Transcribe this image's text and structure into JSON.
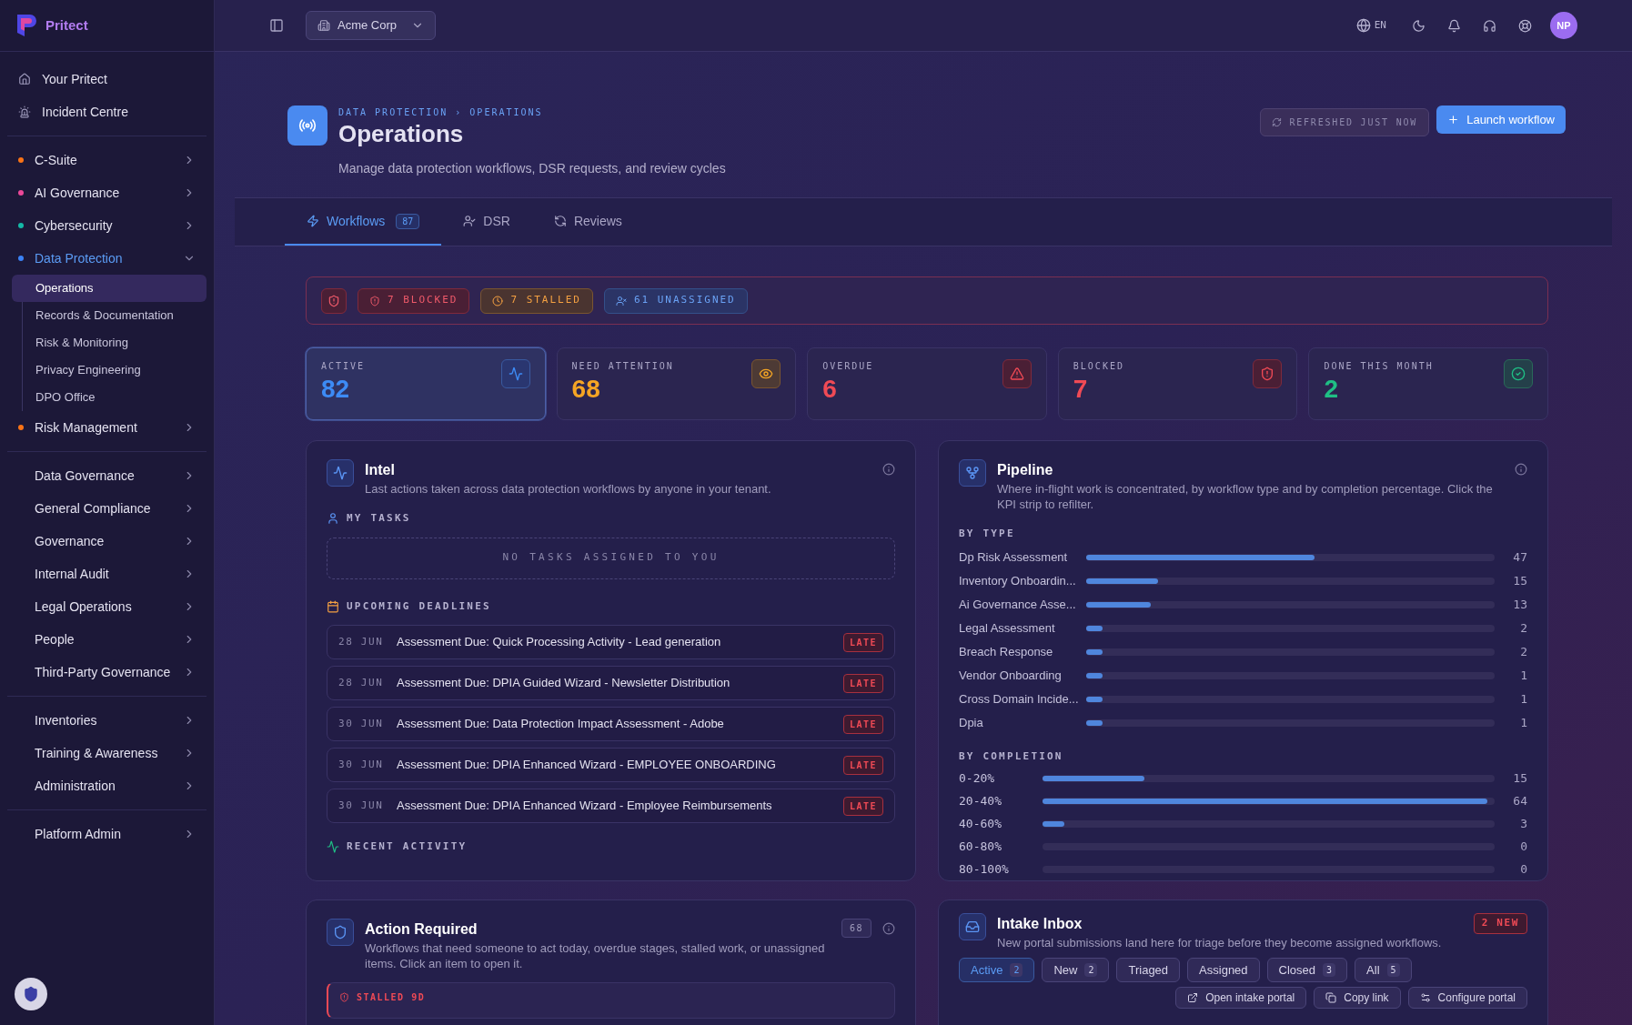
{
  "brand": {
    "name": "Pritect"
  },
  "sidebar": {
    "links": [
      {
        "label": "Your Pritect"
      },
      {
        "label": "Incident Centre"
      }
    ],
    "sections": [
      [
        {
          "label": "C-Suite",
          "color": "#f97316",
          "expanded": false
        },
        {
          "label": "AI Governance",
          "color": "#ec4899",
          "expanded": false
        },
        {
          "label": "Cybersecurity",
          "color": "#14b8a6",
          "expanded": false
        },
        {
          "label": "Data Protection",
          "color": "#3b82f6",
          "expanded": true,
          "children": [
            {
              "label": "Operations",
              "selected": true
            },
            {
              "label": "Records & Documentation",
              "selected": false
            },
            {
              "label": "Risk & Monitoring",
              "selected": false
            },
            {
              "label": "Privacy Engineering",
              "selected": false
            },
            {
              "label": "DPO Office",
              "selected": false
            }
          ]
        },
        {
          "label": "Risk Management",
          "color": "#f97316",
          "expanded": false
        }
      ],
      [
        {
          "label": "Data Governance",
          "expanded": false
        },
        {
          "label": "General Compliance",
          "expanded": false
        },
        {
          "label": "Governance",
          "expanded": false
        },
        {
          "label": "Internal Audit",
          "expanded": false
        },
        {
          "label": "Legal Operations",
          "expanded": false
        },
        {
          "label": "People",
          "expanded": false
        },
        {
          "label": "Third-Party Governance",
          "expanded": false
        }
      ],
      [
        {
          "label": "Inventories",
          "expanded": false
        },
        {
          "label": "Training & Awareness",
          "expanded": false
        },
        {
          "label": "Administration",
          "expanded": false
        }
      ],
      [
        {
          "label": "Platform Admin",
          "expanded": false
        }
      ]
    ]
  },
  "topbar": {
    "organization": "Acme Corp",
    "language": "EN",
    "avatar": "NP"
  },
  "page": {
    "breadcrumb": [
      "DATA PROTECTION",
      "OPERATIONS"
    ],
    "separator": "›",
    "title": "Operations",
    "subtitle": "Manage data protection workflows, DSR requests, and review cycles",
    "refresh": "REFRESHED JUST NOW",
    "launch": "Launch workflow"
  },
  "tabs": [
    {
      "label": "Workflows",
      "count": "87",
      "selected": true
    },
    {
      "label": "DSR",
      "selected": false
    },
    {
      "label": "Reviews",
      "selected": false
    }
  ],
  "alerts": [
    {
      "kind": "blocked",
      "label": "7 BLOCKED"
    },
    {
      "kind": "stalled",
      "label": "7 STALLED"
    },
    {
      "kind": "unassigned",
      "label": "61 UNASSIGNED"
    }
  ],
  "kpis": [
    {
      "kind": "active",
      "label": "ACTIVE",
      "value": "82",
      "selected": true
    },
    {
      "kind": "attention",
      "label": "NEED ATTENTION",
      "value": "68",
      "selected": false
    },
    {
      "kind": "overdue",
      "label": "OVERDUE",
      "value": "6",
      "selected": false
    },
    {
      "kind": "blocked",
      "label": "BLOCKED",
      "value": "7",
      "selected": false
    },
    {
      "kind": "done",
      "label": "DONE THIS MONTH",
      "value": "2",
      "selected": false
    }
  ],
  "intel": {
    "title": "Intel",
    "description": "Last actions taken across data protection workflows by anyone in your tenant.",
    "my_tasks": "MY TASKS",
    "empty": "NO TASKS ASSIGNED TO YOU",
    "deadlines_heading": "UPCOMING DEADLINES",
    "deadlines": [
      {
        "date": "28 JUN",
        "title": "Assessment Due: Quick Processing Activity - Lead generation",
        "status": "LATE"
      },
      {
        "date": "28 JUN",
        "title": "Assessment Due: DPIA Guided Wizard - Newsletter Distribution",
        "status": "LATE"
      },
      {
        "date": "30 JUN",
        "title": "Assessment Due: Data Protection Impact Assessment - Adobe",
        "status": "LATE"
      },
      {
        "date": "30 JUN",
        "title": "Assessment Due: DPIA Enhanced Wizard - EMPLOYEE ONBOARDING",
        "status": "LATE"
      },
      {
        "date": "30 JUN",
        "title": "Assessment Due: DPIA Enhanced Wizard - Employee Reimbursements",
        "status": "LATE"
      }
    ],
    "recent_heading": "RECENT ACTIVITY"
  },
  "pipeline": {
    "title": "Pipeline",
    "description": "Where in-flight work is concentrated, by workflow type and by completion percentage. Click the KPI strip to refilter.",
    "by_type_heading": "BY TYPE",
    "by_type": [
      {
        "label": "Dp Risk Assessment",
        "level": 0.57,
        "count": "47"
      },
      {
        "label": "Inventory Onboardin...",
        "level": 0.18,
        "count": "15"
      },
      {
        "label": "Ai Governance Asse...",
        "level": 0.16,
        "count": "13"
      },
      {
        "label": "Legal Assessment",
        "level": 0.04,
        "count": "2"
      },
      {
        "label": "Breach Response",
        "level": 0.04,
        "count": "2"
      },
      {
        "label": "Vendor Onboarding",
        "level": 0.04,
        "count": "1"
      },
      {
        "label": "Cross Domain Incide...",
        "level": 0.04,
        "count": "1"
      },
      {
        "label": "Dpia",
        "level": 0.04,
        "count": "1"
      }
    ],
    "by_completion_heading": "BY COMPLETION",
    "by_completion": [
      {
        "label": "0-20%",
        "level": 0.23,
        "count": "15"
      },
      {
        "label": "20-40%",
        "level": 1,
        "count": "64"
      },
      {
        "label": "40-60%",
        "level": 0.05,
        "count": "3"
      },
      {
        "label": "60-80%",
        "level": 0,
        "count": "0"
      },
      {
        "label": "80-100%",
        "level": 0,
        "count": "0"
      }
    ]
  },
  "action_required": {
    "title": "Action Required",
    "description": "Workflows that need someone to act today, overdue stages, stalled work, or unassigned items. Click an item to open it.",
    "count": "68",
    "items": [
      {
        "label": "STALLED 9D"
      }
    ]
  },
  "intake": {
    "title": "Intake Inbox",
    "description": "New portal submissions land here for triage before they become assigned workflows.",
    "badge": "2 NEW",
    "filters": [
      {
        "label": "Active",
        "count": "2",
        "selected": true
      },
      {
        "label": "New",
        "count": "2",
        "selected": false
      },
      {
        "label": "Triaged",
        "selected": false
      },
      {
        "label": "Assigned",
        "selected": false
      },
      {
        "label": "Closed",
        "count": "3",
        "selected": false
      },
      {
        "label": "All",
        "count": "5",
        "selected": false
      }
    ],
    "actions": [
      "Open intake portal",
      "Copy link",
      "Configure portal"
    ]
  }
}
